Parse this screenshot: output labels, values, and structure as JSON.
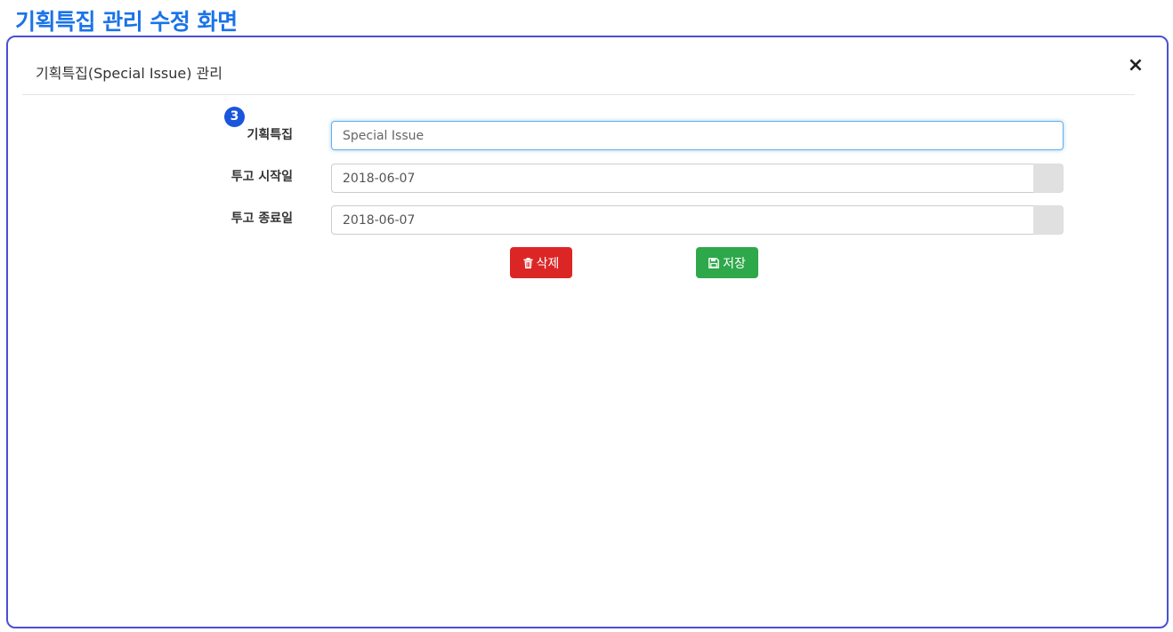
{
  "page_heading": "기획특집 관리 수정 화면",
  "modal": {
    "title": "기획특집(Special Issue) 관리",
    "close_symbol": "×"
  },
  "step_badge": "3",
  "form": {
    "special_issue": {
      "label": "기획특집",
      "placeholder": "Special Issue",
      "value": ""
    },
    "submit_start": {
      "label": "투고 시작일",
      "value": "2018-06-07"
    },
    "submit_end": {
      "label": "투고 종료일",
      "value": "2018-06-07"
    }
  },
  "buttons": {
    "delete": {
      "label": "삭제",
      "icon": "trash-icon",
      "color": "#dc2626"
    },
    "save": {
      "label": "저장",
      "icon": "floppy-disk-icon",
      "color": "#2ea84a"
    }
  },
  "colors": {
    "heading": "#1a73e8",
    "frame_border": "#4b4fd6",
    "badge": "#1a56db"
  }
}
